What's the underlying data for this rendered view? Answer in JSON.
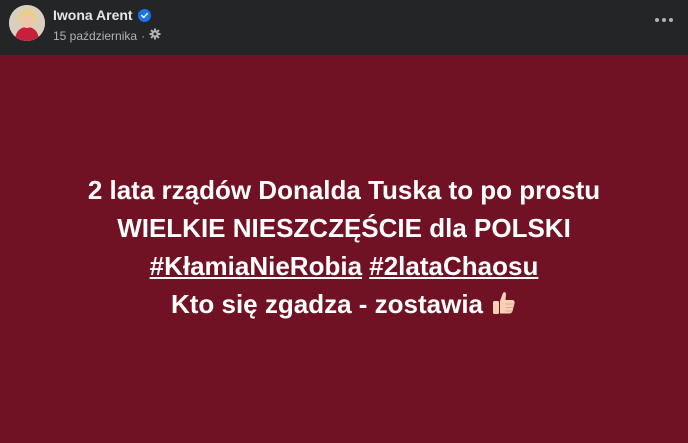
{
  "post": {
    "author_name": "Iwona Arent",
    "date": "15 października",
    "separator": "·",
    "colors": {
      "background": "#711224",
      "header": "#242526",
      "verified": "#1b74e4"
    },
    "body": {
      "line1": "2 lata rządów Donalda Tuska to po prostu",
      "line2": "WIELKIE NIESZCZĘŚCIE dla POLSKI",
      "hashtag1": "#KłamiaNieRobia",
      "hashtag2": "#2lataChaosu",
      "line4": "Kto się zgadza - zostawia"
    },
    "icons": {
      "verified": "verified-badge-icon",
      "audience": "gear-icon",
      "more": "more-options-icon",
      "emoji": "thumbs-up-icon"
    }
  }
}
